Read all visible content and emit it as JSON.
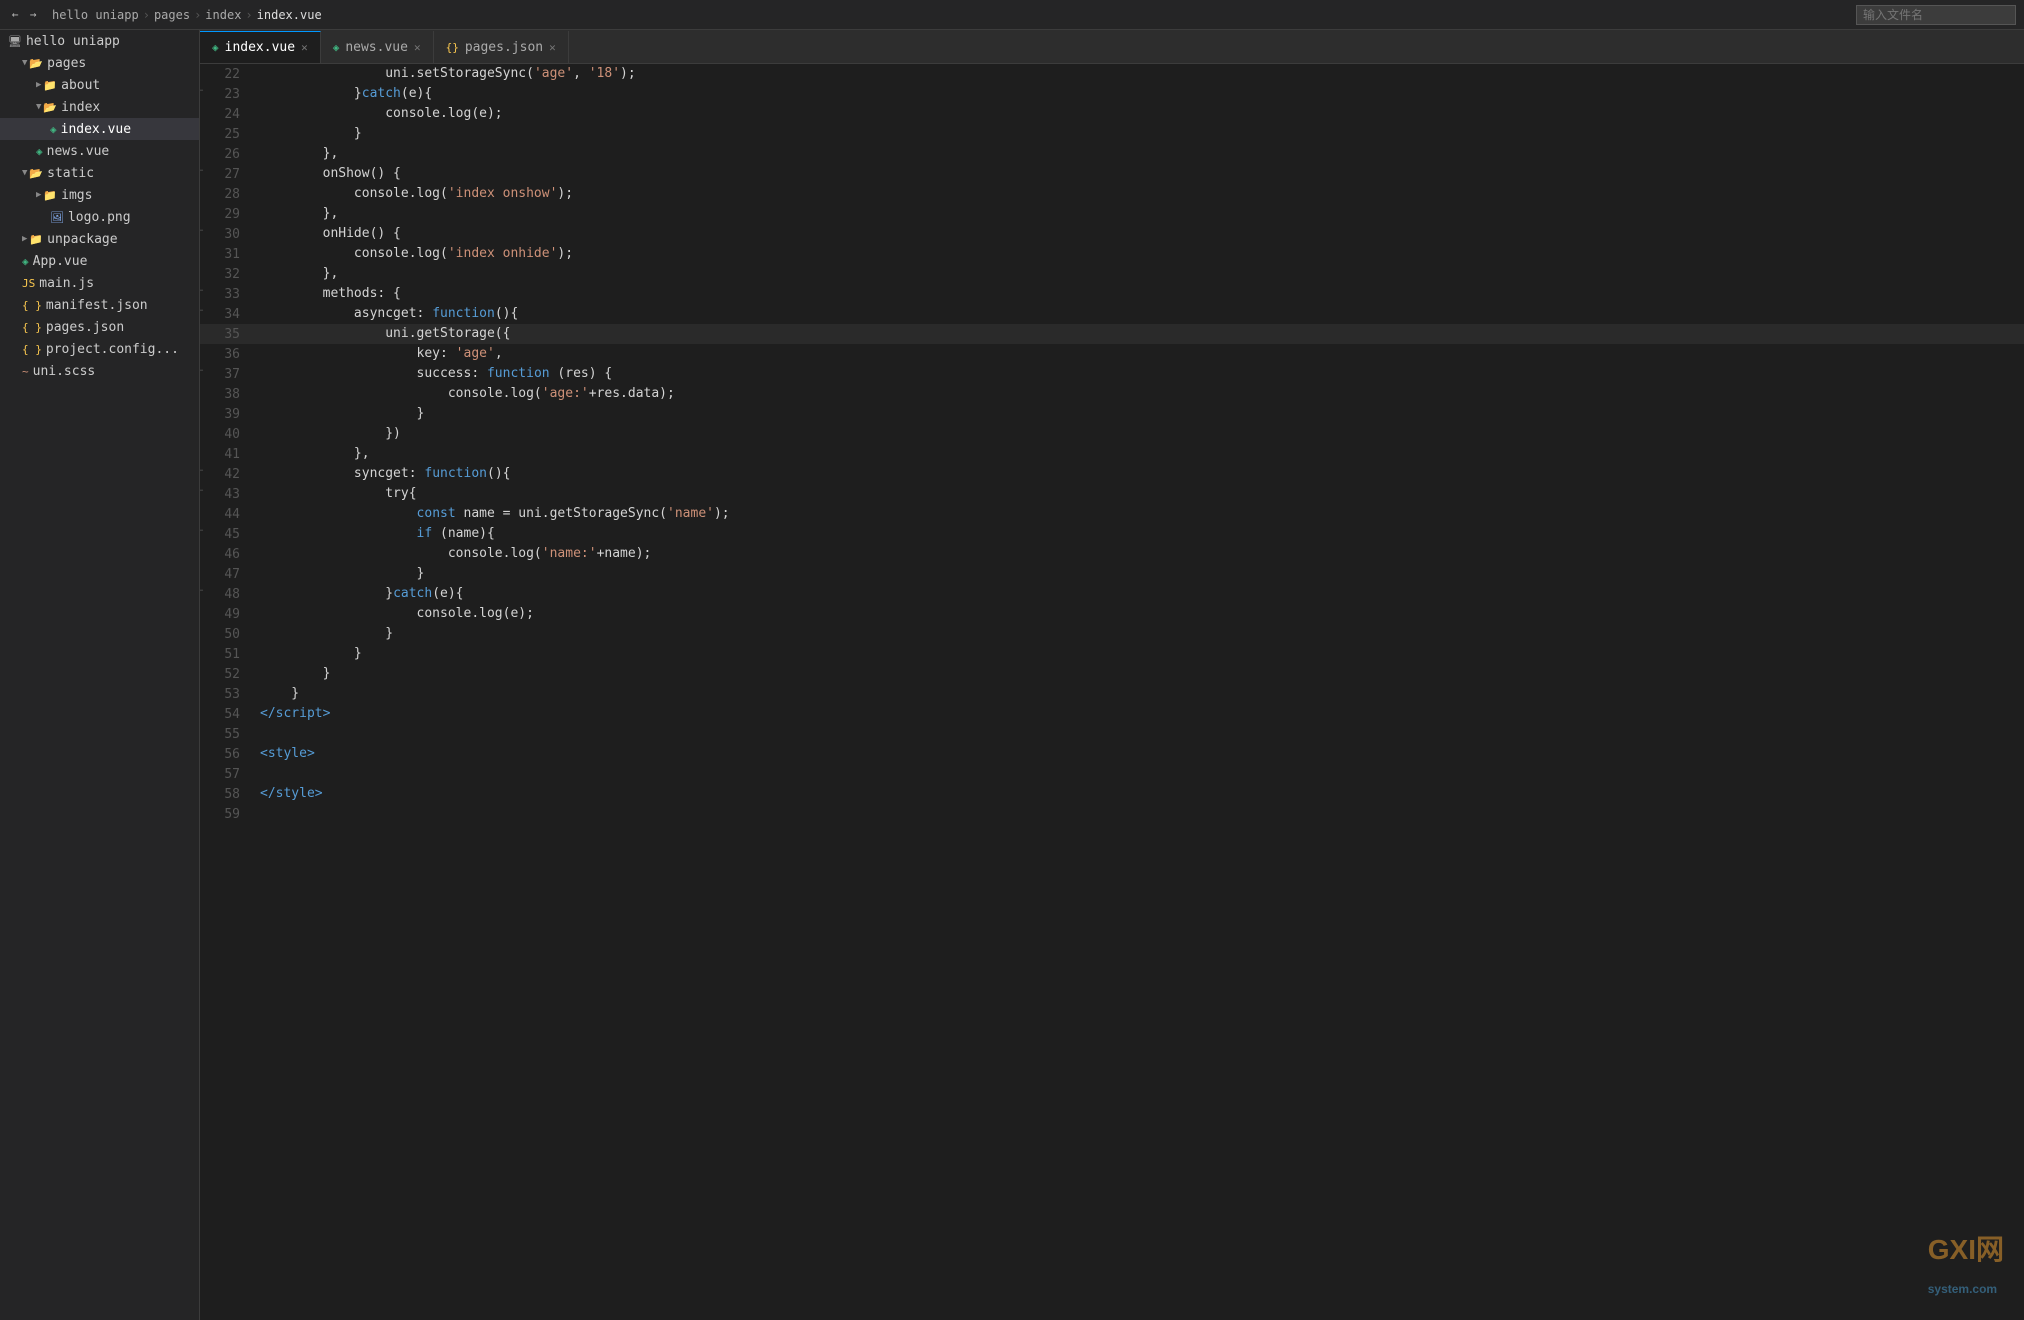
{
  "topbar": {
    "breadcrumb": [
      "hello uniapp",
      "pages",
      "index",
      "index.vue"
    ],
    "search_placeholder": "输入文件名"
  },
  "tabs": [
    {
      "label": "index.vue",
      "type": "vue",
      "active": true
    },
    {
      "label": "news.vue",
      "type": "vue",
      "active": false
    },
    {
      "label": "pages.json",
      "type": "json",
      "active": false
    }
  ],
  "sidebar": {
    "tree": [
      {
        "level": 0,
        "label": "hello uniapp",
        "type": "root",
        "expanded": true,
        "icon": "computer"
      },
      {
        "level": 1,
        "label": "pages",
        "type": "folder",
        "expanded": true
      },
      {
        "level": 2,
        "label": "about",
        "type": "folder",
        "expanded": false
      },
      {
        "level": 2,
        "label": "index",
        "type": "folder",
        "expanded": true
      },
      {
        "level": 3,
        "label": "index.vue",
        "type": "vue",
        "active": true
      },
      {
        "level": 2,
        "label": "news.vue",
        "type": "vue",
        "active": false
      },
      {
        "level": 1,
        "label": "static",
        "type": "folder",
        "expanded": true
      },
      {
        "level": 2,
        "label": "imgs",
        "type": "folder",
        "expanded": false
      },
      {
        "level": 3,
        "label": "logo.png",
        "type": "png"
      },
      {
        "level": 1,
        "label": "unpackage",
        "type": "folder",
        "expanded": false
      },
      {
        "level": 1,
        "label": "App.vue",
        "type": "vue"
      },
      {
        "level": 1,
        "label": "main.js",
        "type": "js"
      },
      {
        "level": 1,
        "label": "manifest.json",
        "type": "json"
      },
      {
        "level": 1,
        "label": "pages.json",
        "type": "json"
      },
      {
        "level": 1,
        "label": "project.config...",
        "type": "json"
      },
      {
        "level": 1,
        "label": "uni.scss",
        "type": "scss"
      }
    ]
  },
  "code": {
    "lines": [
      {
        "num": 22,
        "tokens": [
          {
            "t": "plain",
            "v": "                uni.setStorageSync("
          },
          {
            "t": "string",
            "v": "'age'"
          },
          {
            "t": "plain",
            "v": ", "
          },
          {
            "t": "string",
            "v": "'18'"
          },
          {
            "t": "plain",
            "v": ");"
          }
        ],
        "fold": false
      },
      {
        "num": 23,
        "tokens": [
          {
            "t": "plain",
            "v": "            }"
          },
          {
            "t": "keyword",
            "v": "catch"
          },
          {
            "t": "plain",
            "v": "(e){"
          }
        ],
        "fold": true
      },
      {
        "num": 24,
        "tokens": [
          {
            "t": "plain",
            "v": "                console.log(e);"
          }
        ],
        "fold": false
      },
      {
        "num": 25,
        "tokens": [
          {
            "t": "plain",
            "v": "            }"
          }
        ],
        "fold": false
      },
      {
        "num": 26,
        "tokens": [
          {
            "t": "plain",
            "v": "        },"
          }
        ],
        "fold": false
      },
      {
        "num": 27,
        "tokens": [
          {
            "t": "plain",
            "v": "        onShow() {"
          }
        ],
        "fold": true
      },
      {
        "num": 28,
        "tokens": [
          {
            "t": "plain",
            "v": "            console.log("
          },
          {
            "t": "string",
            "v": "'index onshow'"
          },
          {
            "t": "plain",
            "v": ");"
          }
        ],
        "fold": false
      },
      {
        "num": 29,
        "tokens": [
          {
            "t": "plain",
            "v": "        },"
          }
        ],
        "fold": false
      },
      {
        "num": 30,
        "tokens": [
          {
            "t": "plain",
            "v": "        onHide() {"
          }
        ],
        "fold": true
      },
      {
        "num": 31,
        "tokens": [
          {
            "t": "plain",
            "v": "            console.log("
          },
          {
            "t": "string",
            "v": "'index onhide'"
          },
          {
            "t": "plain",
            "v": ");"
          }
        ],
        "fold": false
      },
      {
        "num": 32,
        "tokens": [
          {
            "t": "plain",
            "v": "        },"
          }
        ],
        "fold": false
      },
      {
        "num": 33,
        "tokens": [
          {
            "t": "plain",
            "v": "        methods: {"
          }
        ],
        "fold": true
      },
      {
        "num": 34,
        "tokens": [
          {
            "t": "plain",
            "v": "            asyncget: "
          },
          {
            "t": "keyword",
            "v": "function"
          },
          {
            "t": "plain",
            "v": "(){"
          }
        ],
        "fold": true
      },
      {
        "num": 35,
        "tokens": [
          {
            "t": "plain",
            "v": "                uni.getStorage({"
          }
        ],
        "fold": false,
        "active": true
      },
      {
        "num": 36,
        "tokens": [
          {
            "t": "plain",
            "v": "                    key: "
          },
          {
            "t": "string",
            "v": "'age'"
          },
          {
            "t": "plain",
            "v": ","
          }
        ],
        "fold": false
      },
      {
        "num": 37,
        "tokens": [
          {
            "t": "plain",
            "v": "                    success: "
          },
          {
            "t": "keyword",
            "v": "function"
          },
          {
            "t": "plain",
            "v": " (res) {"
          }
        ],
        "fold": true
      },
      {
        "num": 38,
        "tokens": [
          {
            "t": "plain",
            "v": "                        console.log("
          },
          {
            "t": "string",
            "v": "'age:'"
          },
          {
            "t": "plain",
            "v": "+res.data);"
          }
        ],
        "fold": false
      },
      {
        "num": 39,
        "tokens": [
          {
            "t": "plain",
            "v": "                    }"
          }
        ],
        "fold": false
      },
      {
        "num": 40,
        "tokens": [
          {
            "t": "plain",
            "v": "                })"
          }
        ],
        "fold": false
      },
      {
        "num": 41,
        "tokens": [
          {
            "t": "plain",
            "v": "            },"
          }
        ],
        "fold": false
      },
      {
        "num": 42,
        "tokens": [
          {
            "t": "plain",
            "v": "            syncget: "
          },
          {
            "t": "keyword",
            "v": "function"
          },
          {
            "t": "plain",
            "v": "(){"
          }
        ],
        "fold": true
      },
      {
        "num": 43,
        "tokens": [
          {
            "t": "plain",
            "v": "                try{"
          }
        ],
        "fold": true
      },
      {
        "num": 44,
        "tokens": [
          {
            "t": "plain",
            "v": "                    "
          },
          {
            "t": "keyword",
            "v": "const"
          },
          {
            "t": "plain",
            "v": " name = uni.getStorageSync("
          },
          {
            "t": "string",
            "v": "'name'"
          },
          {
            "t": "plain",
            "v": ");"
          }
        ],
        "fold": false
      },
      {
        "num": 45,
        "tokens": [
          {
            "t": "plain",
            "v": "                    "
          },
          {
            "t": "keyword",
            "v": "if"
          },
          {
            "t": "plain",
            "v": " (name){"
          }
        ],
        "fold": true
      },
      {
        "num": 46,
        "tokens": [
          {
            "t": "plain",
            "v": "                        console.log("
          },
          {
            "t": "string",
            "v": "'name:'"
          },
          {
            "t": "plain",
            "v": "+name);"
          }
        ],
        "fold": false
      },
      {
        "num": 47,
        "tokens": [
          {
            "t": "plain",
            "v": "                    }"
          }
        ],
        "fold": false
      },
      {
        "num": 48,
        "tokens": [
          {
            "t": "plain",
            "v": "                }"
          },
          {
            "t": "keyword",
            "v": "catch"
          },
          {
            "t": "plain",
            "v": "(e){"
          }
        ],
        "fold": true
      },
      {
        "num": 49,
        "tokens": [
          {
            "t": "plain",
            "v": "                    console.log(e);"
          }
        ],
        "fold": false
      },
      {
        "num": 50,
        "tokens": [
          {
            "t": "plain",
            "v": "                }"
          }
        ],
        "fold": false
      },
      {
        "num": 51,
        "tokens": [
          {
            "t": "plain",
            "v": "            }"
          }
        ],
        "fold": false
      },
      {
        "num": 52,
        "tokens": [
          {
            "t": "plain",
            "v": "        }"
          }
        ],
        "fold": false
      },
      {
        "num": 53,
        "tokens": [
          {
            "t": "plain",
            "v": "    }"
          }
        ],
        "fold": false
      },
      {
        "num": 54,
        "tokens": [
          {
            "t": "tag",
            "v": "</script"
          },
          {
            "t": "tag",
            "v": ">"
          }
        ],
        "fold": false
      },
      {
        "num": 55,
        "tokens": [
          {
            "t": "plain",
            "v": ""
          }
        ],
        "fold": false
      },
      {
        "num": 56,
        "tokens": [
          {
            "t": "tag",
            "v": "<style"
          },
          {
            "t": "tag",
            "v": ">"
          }
        ],
        "fold": false
      },
      {
        "num": 57,
        "tokens": [
          {
            "t": "plain",
            "v": ""
          }
        ],
        "fold": false
      },
      {
        "num": 58,
        "tokens": [
          {
            "t": "tag",
            "v": "</style"
          },
          {
            "t": "tag",
            "v": ">"
          }
        ],
        "fold": false
      },
      {
        "num": 59,
        "tokens": [
          {
            "t": "plain",
            "v": ""
          }
        ],
        "fold": false
      }
    ]
  },
  "watermark": {
    "text1": "GX",
    "sep": "I",
    "text2": "网",
    "sub": "system.com"
  }
}
